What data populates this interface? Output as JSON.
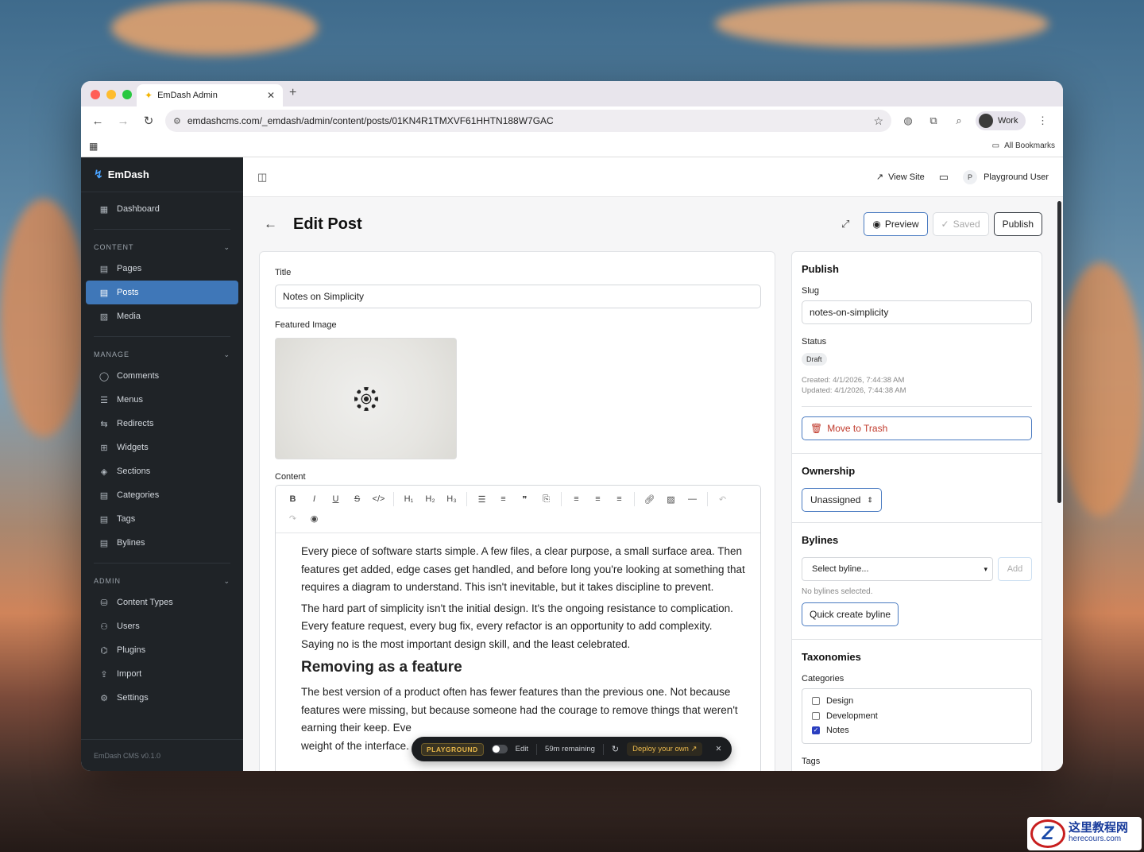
{
  "browser": {
    "tab_title": "EmDash Admin",
    "url": "emdashcms.com/_emdash/admin/content/posts/01KN4R1TMXVF61HHTN188W7GAC",
    "profile": "Work",
    "bookmarks_label": "All Bookmarks"
  },
  "sidebar": {
    "brand": "EmDash",
    "dashboard": "Dashboard",
    "content_heading": "CONTENT",
    "content_items": [
      "Pages",
      "Posts",
      "Media"
    ],
    "manage_heading": "MANAGE",
    "manage_items": [
      "Comments",
      "Menus",
      "Redirects",
      "Widgets",
      "Sections",
      "Categories",
      "Tags",
      "Bylines"
    ],
    "admin_heading": "ADMIN",
    "admin_items": [
      "Content Types",
      "Users",
      "Plugins",
      "Import",
      "Settings"
    ],
    "footer": "EmDash CMS v0.1.0",
    "active_item": "Posts"
  },
  "topbar": {
    "view_site": "View Site",
    "user_initial": "P",
    "user_name": "Playground User"
  },
  "page": {
    "title": "Edit Post",
    "preview": "Preview",
    "saved": "Saved",
    "publish": "Publish"
  },
  "editor": {
    "title_label": "Title",
    "title_value": "Notes on Simplicity",
    "featured_label": "Featured Image",
    "content_label": "Content",
    "paragraph1": "Every piece of software starts simple. A few files, a clear purpose, a small surface area. Then features get added, edge cases get handled, and before long you're looking at something that requires a diagram to understand. This isn't inevitable, but it takes discipline to prevent.",
    "paragraph2": "The hard part of simplicity isn't the initial design. It's the ongoing resistance to complication. Every feature request, every bug fix, every refactor is an opportunity to add complexity. Saying no is the most important design skill, and the least celebrated.",
    "heading": "Removing as a feature",
    "paragraph3": "The best version of a product often has fewer features than the previous one. Not because features were missing, but because someone had the courage to remove things that weren't earning their keep. Eve",
    "paragraph3_tail": "weight of the interface."
  },
  "publish_panel": {
    "title": "Publish",
    "slug_label": "Slug",
    "slug_value": "notes-on-simplicity",
    "status_label": "Status",
    "status_value": "Draft",
    "created": "Created: 4/1/2026, 7:44:38 AM",
    "updated": "Updated: 4/1/2026, 7:44:38 AM",
    "trash": "Move to Trash"
  },
  "ownership": {
    "title": "Ownership",
    "value": "Unassigned"
  },
  "bylines": {
    "title": "Bylines",
    "select_placeholder": "Select byline...",
    "add": "Add",
    "empty": "No bylines selected.",
    "quick_create": "Quick create byline"
  },
  "taxonomies": {
    "title": "Taxonomies",
    "categories_label": "Categories",
    "categories": [
      {
        "name": "Design",
        "checked": false
      },
      {
        "name": "Development",
        "checked": false
      },
      {
        "name": "Notes",
        "checked": true
      }
    ],
    "tags_label": "Tags"
  },
  "playground": {
    "badge": "PLAYGROUND",
    "edit": "Edit",
    "remaining": "59m remaining",
    "deploy": "Deploy your own"
  },
  "watermark": {
    "cn": "这里教程网",
    "url": "herecours.com"
  }
}
